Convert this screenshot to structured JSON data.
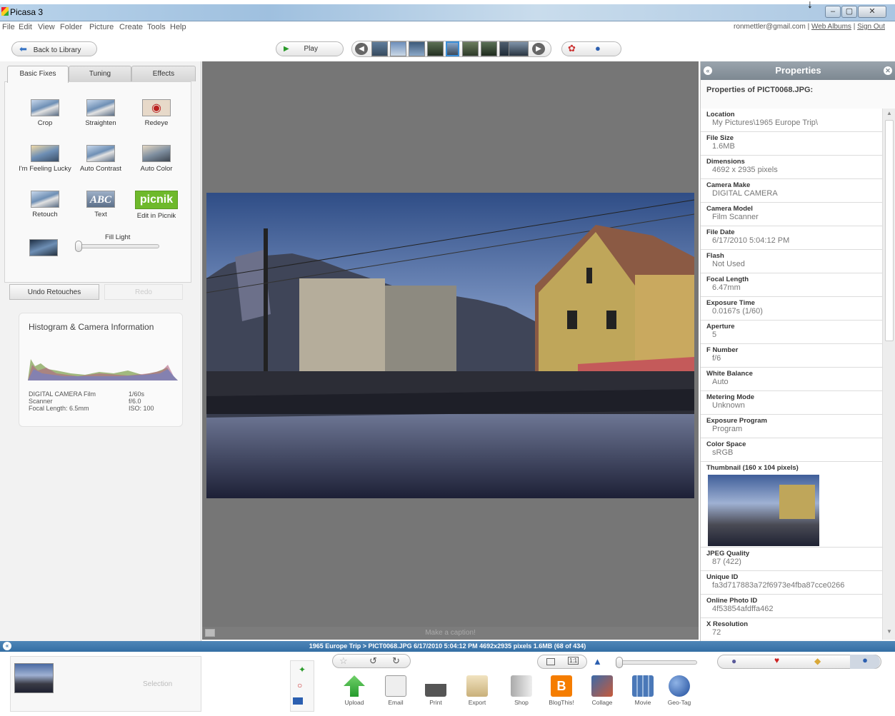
{
  "window": {
    "title": "Picasa 3",
    "buttons": [
      "–",
      "▢",
      "✕"
    ]
  },
  "menu": [
    "File",
    "Edit",
    "View",
    "Folder",
    "Picture",
    "Create",
    "Tools",
    "Help"
  ],
  "account": {
    "email": "ronmettler@gmail.com",
    "sep": "|",
    "web_albums": "Web Albums",
    "sign_out": "Sign Out"
  },
  "toolbar": {
    "back": "Back to Library",
    "play": "Play"
  },
  "tabs": [
    "Basic Fixes",
    "Tuning",
    "Effects"
  ],
  "tools": [
    {
      "label": "Crop",
      "icon": "crop-icon"
    },
    {
      "label": "Straighten",
      "icon": "straighten-icon"
    },
    {
      "label": "Redeye",
      "icon": "redeye-icon"
    },
    {
      "label": "I'm Feeling Lucky",
      "icon": "lucky-icon"
    },
    {
      "label": "Auto Contrast",
      "icon": "auto-contrast-icon"
    },
    {
      "label": "Auto Color",
      "icon": "auto-color-icon"
    },
    {
      "label": "Retouch",
      "icon": "retouch-icon"
    },
    {
      "label": "Text",
      "icon": "text-icon"
    },
    {
      "label": "Edit in Picnik",
      "icon": "picnik-icon"
    }
  ],
  "fill_light": {
    "label": "Fill Light"
  },
  "picnik_logo": "picnik",
  "text_tool_glyph": "ABC",
  "undo": {
    "label": "Undo Retouches",
    "redo": "Redo"
  },
  "histogram": {
    "title": "Histogram & Camera Information",
    "camera": "DIGITAL CAMERA  Film",
    "camera2": "Scanner",
    "focal": "Focal Length: 6.5mm",
    "exposure": "1/60s",
    "fnum": "f/6.0",
    "iso": "ISO: 100"
  },
  "caption": {
    "placeholder": "Make a caption!"
  },
  "properties": {
    "header": "Properties",
    "subtitle": "Properties of PICT0068.JPG:",
    "items": [
      {
        "k": "Location",
        "v": "My Pictures\\1965 Europe Trip\\"
      },
      {
        "k": "File Size",
        "v": "1.6MB"
      },
      {
        "k": "Dimensions",
        "v": "4692 x 2935 pixels"
      },
      {
        "k": "Camera Make",
        "v": "DIGITAL CAMERA"
      },
      {
        "k": "Camera Model",
        "v": "Film Scanner"
      },
      {
        "k": "File Date",
        "v": "6/17/2010 5:04:12 PM"
      },
      {
        "k": "Flash",
        "v": "Not Used"
      },
      {
        "k": "Focal Length",
        "v": "6.47mm"
      },
      {
        "k": "Exposure Time",
        "v": "0.0167s (1/60)"
      },
      {
        "k": "Aperture",
        "v": "5"
      },
      {
        "k": "F Number",
        "v": "f/6"
      },
      {
        "k": "White Balance",
        "v": "Auto"
      },
      {
        "k": "Metering Mode",
        "v": "Unknown"
      },
      {
        "k": "Exposure Program",
        "v": "Program"
      },
      {
        "k": "Color Space",
        "v": "sRGB"
      }
    ],
    "thumb_label": "Thumbnail (160 x 104 pixels)",
    "items2": [
      {
        "k": "JPEG Quality",
        "v": "87 (422)"
      },
      {
        "k": "Unique ID",
        "v": "fa3d717883a72f6973e4fba87cce0266"
      },
      {
        "k": "Online Photo ID",
        "v": "4f53854afdffa462"
      },
      {
        "k": "X Resolution",
        "v": "72"
      }
    ]
  },
  "status": "1965 Europe Trip > PICT0068.JPG    6/17/2010 5:04:12 PM    4692x2935 pixels    1.6MB    (68 of 434)",
  "bottom": {
    "selection": "Selection",
    "one_to_one": "1:1",
    "actions": [
      "Upload",
      "Email",
      "Print",
      "Export",
      "Shop",
      "BlogThis!",
      "Collage",
      "Movie",
      "Geo-Tag"
    ]
  }
}
